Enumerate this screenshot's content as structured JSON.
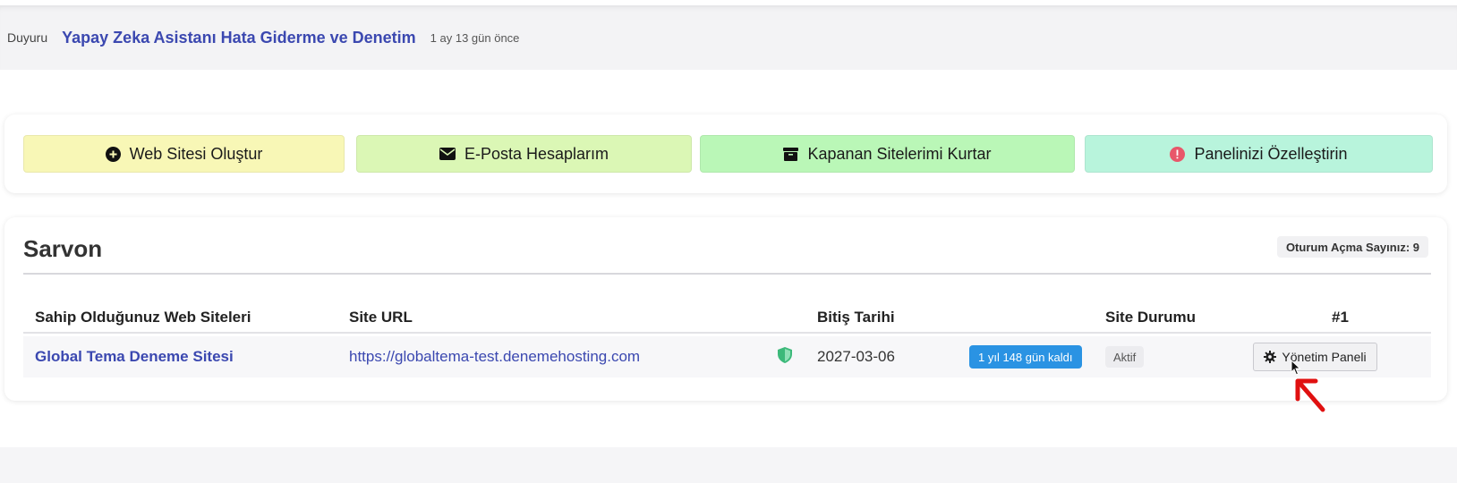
{
  "announcement": {
    "tag": "Duyuru",
    "title": "Yapay Zeka Asistanı Hata Giderme ve Denetim",
    "time": "1 ay 13 gün önce"
  },
  "quick_actions": [
    {
      "label": "Web Sitesi Oluştur",
      "icon": "plus-circle-icon",
      "color": "#f8f7b6"
    },
    {
      "label": "E-Posta Hesaplarım",
      "icon": "envelope-icon",
      "color": "#dbf7b5"
    },
    {
      "label": "Kapanan Sitelerimi Kurtar",
      "icon": "archive-icon",
      "color": "#baf7b7"
    },
    {
      "label": "Panelinizi Özelleştirin",
      "icon": "alert-circle-icon",
      "color": "#b8f4dc"
    }
  ],
  "sites": {
    "title": "Sarvon",
    "login_count_label": "Oturum Açma Sayınız: 9",
    "columns": [
      "Sahip Olduğunuz Web Siteleri",
      "Site URL",
      "Bitiş Tarihi",
      "Site Durumu",
      "#1"
    ],
    "rows": [
      {
        "name": "Global Tema Deneme Sitesi",
        "url": "https://globaltema-test.denemehosting.com",
        "ssl_icon": "shield-icon",
        "end_date": "2027-03-06",
        "days_left": "1 yıl 148 gün kaldı",
        "status": "Aktif",
        "action_label": "Yönetim Paneli",
        "action_icon": "gear-icon"
      }
    ]
  },
  "colors": {
    "link": "#3b48b0",
    "days_badge": "#2a93e3",
    "shield": "#3cb97a",
    "arrow": "#e01010"
  }
}
